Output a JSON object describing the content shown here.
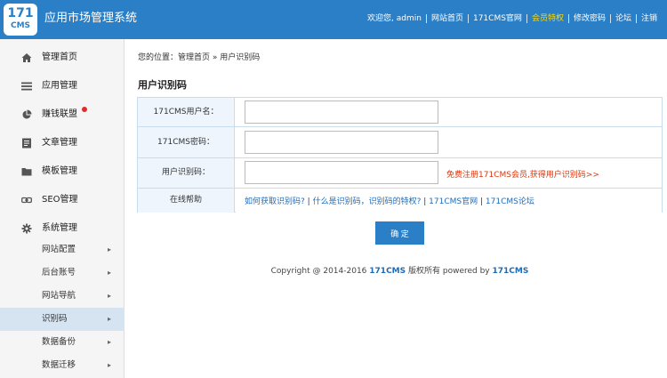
{
  "header": {
    "logo_number": "171",
    "logo_text": "CMS",
    "app_title": "应用市场管理系统",
    "welcome": "欢迎您, admin",
    "links": [
      "网站首页",
      "171CMS官网",
      "会员特权",
      "修改密码",
      "论坛",
      "注销"
    ],
    "highlight_color": "#ffd800",
    "brand_color": "#2b7fc6"
  },
  "sidebar": {
    "items": [
      {
        "label": "管理首页",
        "icon": "home-icon"
      },
      {
        "label": "应用管理",
        "icon": "list-icon"
      },
      {
        "label": "赚钱联盟",
        "icon": "pie-chart-icon",
        "badge": "red-dot"
      },
      {
        "label": "文章管理",
        "icon": "document-icon"
      },
      {
        "label": "模板管理",
        "icon": "folder-icon"
      },
      {
        "label": "SEO管理",
        "icon": "link-icon"
      },
      {
        "label": "系统管理",
        "icon": "gear-icon"
      }
    ],
    "subitems": [
      "网站配置",
      "后台账号",
      "网站导航",
      "识别码",
      "数据备份",
      "数据迁移"
    ],
    "active_subitem": "识别码"
  },
  "breadcrumb": {
    "prefix": "您的位置：",
    "home": "管理首页",
    "sep": "»",
    "current": "用户识别码"
  },
  "page_title": "用户识别码",
  "form": {
    "username_label": "171CMS用户名：",
    "username_value": "",
    "password_label": "171CMS密码：",
    "password_value": "",
    "code_label": "用户识别码：",
    "code_value": "",
    "code_hint": "免费注册171CMS会员,获得用户识别码>>",
    "help_label": "在线帮助",
    "help_links": [
      "如何获取识别码?",
      "什么是识别码，识别码的特权?",
      "171CMS官网",
      "171CMS论坛"
    ],
    "help_sep": "|",
    "submit_label": "确 定"
  },
  "footer": {
    "prefix": "Copyright @ 2014-2016",
    "brand1": "171CMS",
    "middle": "版权所有 powered by",
    "brand2": "171CMS"
  }
}
